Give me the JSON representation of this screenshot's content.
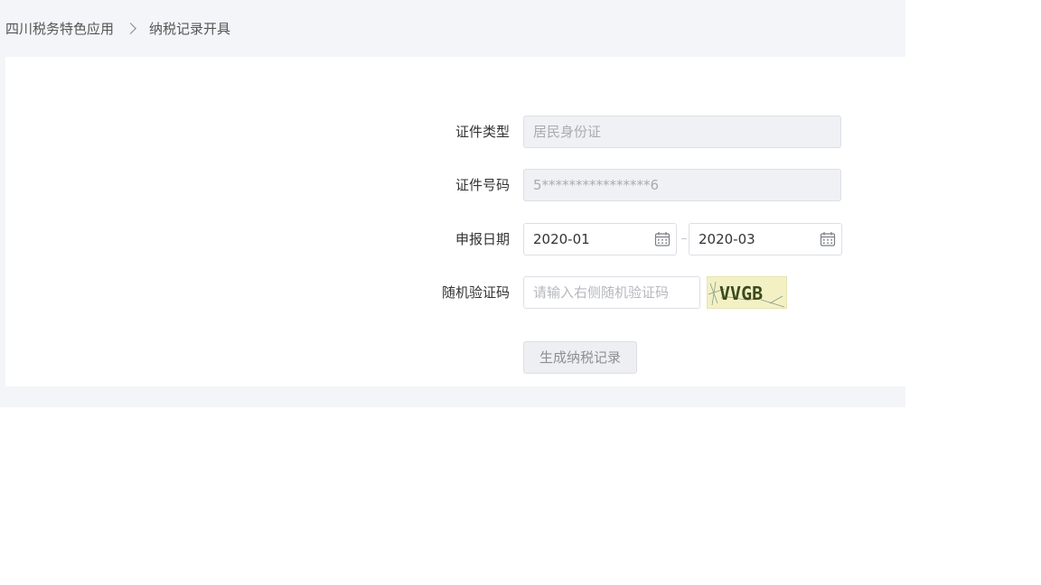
{
  "breadcrumb": {
    "parent": "四川税务特色应用",
    "current": "纳税记录开具"
  },
  "form": {
    "id_type": {
      "label": "证件类型",
      "value": "居民身份证"
    },
    "id_number": {
      "label": "证件号码",
      "value": "5****************6"
    },
    "report_date": {
      "label": "申报日期",
      "start": "2020-01",
      "end": "2020-03"
    },
    "captcha": {
      "label": "随机验证码",
      "placeholder": "请输入右侧随机验证码",
      "image_text": "VVGB"
    },
    "submit_label": "生成纳税记录"
  },
  "colors": {
    "page_bg": "#f4f5f8",
    "disabled_bg": "#f0f1f4",
    "border": "#dcdfe6",
    "captcha_bg": "#f3f1c4"
  }
}
